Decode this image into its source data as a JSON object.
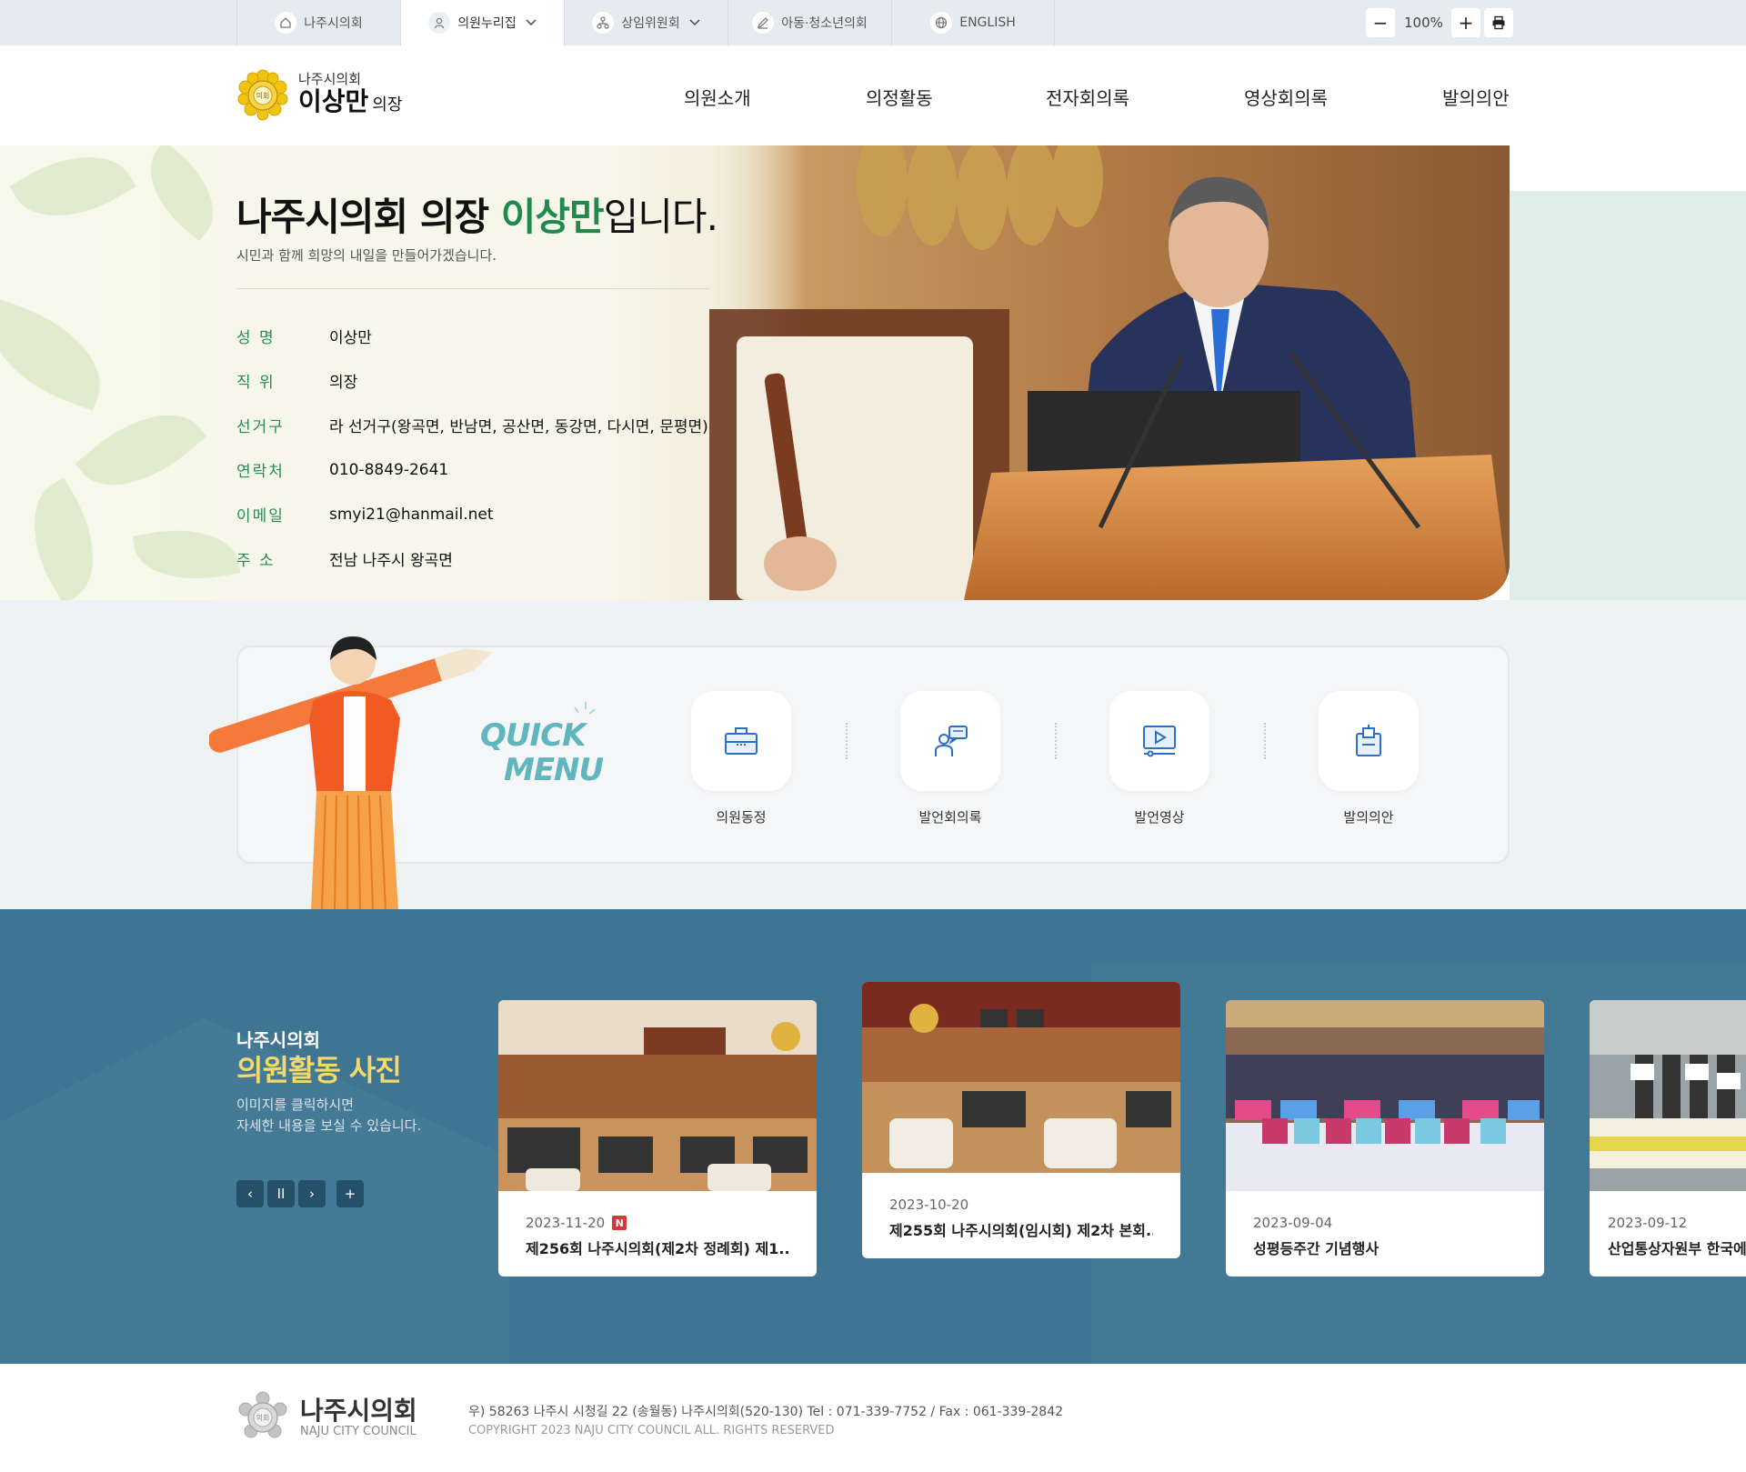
{
  "topbar": {
    "tabs": [
      {
        "label": "나주시의회",
        "icon": "home-icon"
      },
      {
        "label": "의원누리집",
        "icon": "person-icon"
      },
      {
        "label": "상임위원회",
        "icon": "org-icon"
      },
      {
        "label": "아동·청소년의회",
        "icon": "pen-icon"
      },
      {
        "label": "ENGLISH",
        "icon": "globe-icon"
      }
    ],
    "zoom": {
      "minus": "−",
      "value": "100%",
      "plus": "+"
    }
  },
  "header": {
    "logo_small": "나주시의회",
    "logo_name": "이상만",
    "logo_suffix": "의장",
    "nav": [
      "의원소개",
      "의정활동",
      "전자회의록",
      "영상회의록",
      "발의의안"
    ]
  },
  "hero": {
    "title_prefix": "나주시의회 의장 ",
    "title_name": "이상만",
    "title_suffix": "입니다.",
    "subtitle": "시민과 함께 희망의 내일을 만들어가겠습니다.",
    "info": [
      {
        "key": "성 명",
        "value": "이상만"
      },
      {
        "key": "직 위",
        "value": "의장"
      },
      {
        "key": "선거구",
        "value": "라 선거구(왕곡면, 반남면, 공산면, 동강면, 다시면, 문평면)"
      },
      {
        "key": "연락처",
        "value": "010-8849-2641"
      },
      {
        "key": "이메일",
        "value": "smyi21@hanmail.net"
      },
      {
        "key": "주 소",
        "value": "전남 나주시 왕곡면"
      }
    ]
  },
  "quick": {
    "title_line1": "QUICK",
    "title_line2": "MENU",
    "items": [
      {
        "label": "의원동정",
        "icon": "briefcase-icon"
      },
      {
        "label": "발언회의록",
        "icon": "speech-icon"
      },
      {
        "label": "발언영상",
        "icon": "video-icon"
      },
      {
        "label": "발의의안",
        "icon": "document-icon"
      }
    ]
  },
  "photos": {
    "title_small": "나주시의회",
    "title": "의원활동 사진",
    "desc_line1": "이미지를 클릭하시면",
    "desc_line2": "자세한 내용을 보실 수 있습니다.",
    "controls": {
      "prev": "‹",
      "pause": "II",
      "next": "›",
      "more": "+"
    },
    "cards": [
      {
        "date": "2023-11-20",
        "new": "N",
        "title": "제256회 나주시의회(제2차 정례회) 제1..."
      },
      {
        "date": "2023-10-20",
        "title": "제255회 나주시의회(임시회) 제2차 본회..."
      },
      {
        "date": "2023-09-04",
        "title": "성평등주간 기념행사"
      },
      {
        "date": "2023-09-12",
        "title": "산업통상자원부 한국에"
      }
    ]
  },
  "footer": {
    "name": "나주시의회",
    "name_en": "NAJU CITY COUNCIL",
    "address": "우) 58263 나주시 시청길 22 (송월동) 나주시의회(520-130) Tel : 071-339-7752 / Fax : 061-339-2842",
    "copyright": "COPYRIGHT   2023 NAJU CITY COUNCIL ALL. RIGHTS RESERVED"
  },
  "colors": {
    "accent": "#1f8a4c",
    "quick": "#5fb6be",
    "section": "#3f7592",
    "highlight": "#f3d96b"
  }
}
